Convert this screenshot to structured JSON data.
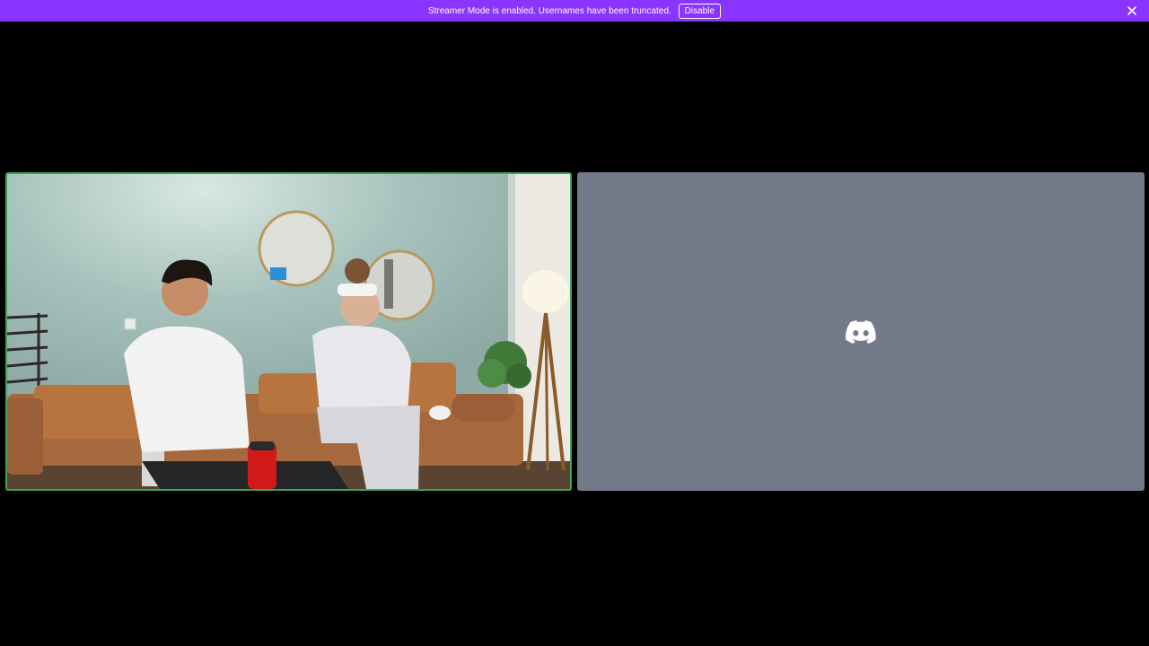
{
  "banner": {
    "message": "Streamer Mode is enabled. Usernames have been truncated.",
    "disable_label": "Disable",
    "close_icon": "close-icon",
    "background": "#8a34ff"
  },
  "call": {
    "tiles": [
      {
        "kind": "video",
        "speaking": true,
        "speaking_color": "#3ba55c"
      },
      {
        "kind": "no-video",
        "icon": "discord-logo-icon",
        "background": "#737b8b"
      }
    ]
  }
}
